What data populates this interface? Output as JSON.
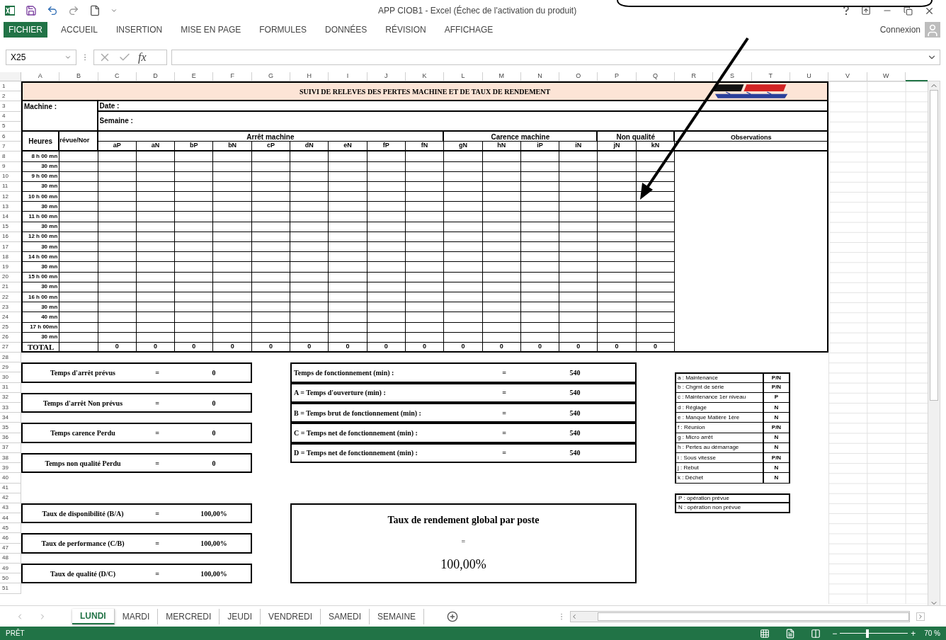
{
  "window": {
    "title": "APP CIOB1 - Excel (Échec de l'activation du produit)"
  },
  "ribbon_tabs": [
    {
      "label": "FICHIER",
      "selected": true
    },
    {
      "label": "ACCUEIL",
      "selected": false
    },
    {
      "label": "INSERTION",
      "selected": false
    },
    {
      "label": "MISE EN PAGE",
      "selected": false
    },
    {
      "label": "FORMULES",
      "selected": false
    },
    {
      "label": "DONNÉES",
      "selected": false
    },
    {
      "label": "RÉVISION",
      "selected": false
    },
    {
      "label": "AFFICHAGE",
      "selected": false
    }
  ],
  "account": {
    "label": "Connexion"
  },
  "formula_bar": {
    "name_box": "X25",
    "function_label": "fx"
  },
  "column_headers": [
    "A",
    "B",
    "C",
    "D",
    "E",
    "F",
    "G",
    "H",
    "I",
    "J",
    "K",
    "L",
    "M",
    "N",
    "O",
    "P",
    "Q",
    "R",
    "S",
    "T",
    "U",
    "V",
    "W"
  ],
  "row_headers": [
    "1",
    "2",
    "3",
    "4",
    "5",
    "6",
    "7",
    "8",
    "9",
    "10",
    "11",
    "12",
    "13",
    "14",
    "15",
    "16",
    "17",
    "18",
    "19",
    "20",
    "21",
    "22",
    "23",
    "24",
    "25",
    "26",
    "27",
    "28",
    "29",
    "30",
    "31",
    "32",
    "33",
    "34",
    "35",
    "36",
    "37",
    "38",
    "39",
    "40",
    "41",
    "42",
    "43",
    "44",
    "45",
    "46",
    "47",
    "48",
    "49",
    "50",
    "51"
  ],
  "sheet": {
    "title": "SUIVI DE RELEVES DES PERTES MACHINE ET DE TAUX DE RENDEMENT",
    "machine_label": "Machine :",
    "date_label": "Date :",
    "week_label": "Semaine :",
    "hours_header": "Heures",
    "planned_header": "révue/Nor",
    "groups": [
      {
        "label": "Arrêt machine",
        "codes": [
          "aP",
          "aN",
          "bP",
          "bN",
          "cP",
          "dN",
          "eN",
          "fP",
          "fN"
        ]
      },
      {
        "label": "Carence machine",
        "codes": [
          "gN",
          "hN",
          "iP",
          "iN"
        ]
      },
      {
        "label": "Non qualité",
        "codes": [
          "jN",
          "kN"
        ]
      }
    ],
    "observations_header": "Observations",
    "time_slots": [
      "8 h 00 mn",
      "30 mn",
      "9 h 00 mn",
      "30 mn",
      "10 h 00 mn",
      "30 mn",
      "11 h 00 mn",
      "30 mn",
      "12 h 00 mn",
      "30 mn",
      "14 h 00 mn",
      "30 mn",
      "15 h 00 mn",
      "30 mn",
      "16 h 00 mn",
      "30 mn",
      "40 mn",
      "17 h 00mn",
      "30 mn"
    ],
    "total_label": "TOTAL",
    "totals": [
      "0",
      "0",
      "0",
      "0",
      "0",
      "0",
      "0",
      "0",
      "0",
      "0",
      "0",
      "0",
      "0",
      "0",
      "0"
    ]
  },
  "summary_left": [
    {
      "label": "Temps d'arrêt prévus",
      "equals": "=",
      "value": "0"
    },
    {
      "label": "Temps d'arrêt  Non prévus",
      "equals": "=",
      "value": "0"
    },
    {
      "label": "Temps carence Perdu",
      "equals": "=",
      "value": "0"
    },
    {
      "label": "Temps non qualité Perdu",
      "equals": "=",
      "value": "0"
    },
    {
      "label": "Taux de disponibilité (B/A)",
      "equals": "=",
      "value": "100,00%"
    },
    {
      "label": "Taux de performance (C/B)",
      "equals": "=",
      "value": "100,00%"
    },
    {
      "label": "Taux de qualité (D/C)",
      "equals": "=",
      "value": "100,00%"
    }
  ],
  "summary_middle": [
    {
      "label": "Temps de fonctionnement (min) :",
      "equals": "=",
      "value": "540"
    },
    {
      "label": "A = Temps d'ouverture (min) :",
      "equals": "=",
      "value": "540"
    },
    {
      "label": "B = Temps brut de fonctionnement (min) :",
      "equals": "=",
      "value": "540"
    },
    {
      "label": "C = Temps net de fonctionnement (min) :",
      "equals": "=",
      "value": "540"
    },
    {
      "label": "D = Temps net de fonctionnement (min) :",
      "equals": "=",
      "value": "540"
    }
  ],
  "overall": {
    "title": "Taux de rendement global par poste",
    "equals": "=",
    "value": "100,00%"
  },
  "legend": [
    {
      "label": "a : Maintenance",
      "code": "P/N"
    },
    {
      "label": "b : Chgmt de série",
      "code": "P/N"
    },
    {
      "label": "c : Maintenance 1er niveau",
      "code": "P"
    },
    {
      "label": "d : Réglage",
      "code": "N"
    },
    {
      "label": "e : Manque Matière 1ère",
      "code": "N"
    },
    {
      "label": "f : Réunion",
      "code": "P/N"
    },
    {
      "label": "g : Micro arrêt",
      "code": "N"
    },
    {
      "label": "h : Pertes au démarrage",
      "code": "N"
    },
    {
      "label": "i : Sous vitesse",
      "code": "P/N"
    },
    {
      "label": "j : Rebut",
      "code": "N"
    },
    {
      "label": "k : Déchet",
      "code": "N"
    }
  ],
  "legend_notes": [
    "P : opération prévue",
    "N : opération non prévue"
  ],
  "sheet_tabs": [
    {
      "label": "LUNDI",
      "selected": true
    },
    {
      "label": "MARDI",
      "selected": false
    },
    {
      "label": "MERCREDI",
      "selected": false
    },
    {
      "label": "JEUDI",
      "selected": false
    },
    {
      "label": "VENDREDI",
      "selected": false
    },
    {
      "label": "SAMEDI",
      "selected": false
    },
    {
      "label": "SEMAINE",
      "selected": false
    }
  ],
  "status": {
    "text": "PRÊT",
    "zoom_minus": "−",
    "zoom_plus": "+",
    "zoom": "70 %",
    "level": 0.4
  }
}
